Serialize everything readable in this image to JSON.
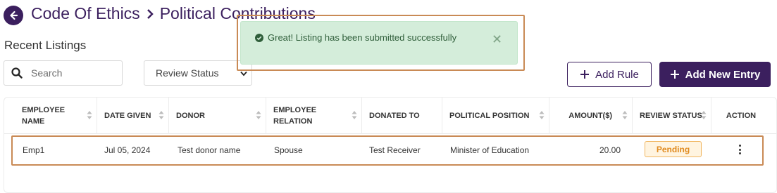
{
  "header": {
    "breadcrumb_parent": "Code Of Ethics",
    "breadcrumb_current": "Political Contributions"
  },
  "section_title": "Recent Listings",
  "search": {
    "placeholder": "Search",
    "value": ""
  },
  "filter": {
    "selected": "Review Status"
  },
  "buttons": {
    "add_rule": "Add Rule",
    "add_new_entry": "Add New Entry"
  },
  "toast": {
    "message": "Great! Listing has been submitted successfully",
    "close_glyph": "✕"
  },
  "table": {
    "columns": [
      {
        "key": "employee_name",
        "label": "EMPLOYEE NAME"
      },
      {
        "key": "date_given",
        "label": "DATE GIVEN"
      },
      {
        "key": "donor",
        "label": "DONOR"
      },
      {
        "key": "employee_relation",
        "label": "EMPLOYEE RELATION"
      },
      {
        "key": "donated_to",
        "label": "DONATED TO"
      },
      {
        "key": "political_position",
        "label": "POLITICAL POSITION"
      },
      {
        "key": "amount",
        "label": "AMOUNT($)"
      },
      {
        "key": "review_status",
        "label": "REVIEW STATUS"
      },
      {
        "key": "action",
        "label": "ACTION"
      }
    ],
    "rows": [
      {
        "employee_name": "Emp1",
        "date_given": "Jul 05, 2024",
        "donor": "Test donor name",
        "employee_relation": "Spouse",
        "donated_to": "Test Receiver",
        "political_position": "Minister of Education",
        "amount": "20.00",
        "review_status": "Pending"
      }
    ]
  },
  "colors": {
    "brand": "#3b1f5e",
    "toast_bg": "#d4edda",
    "pending_border": "#f0b55f",
    "pending_text": "#e08a1e"
  }
}
